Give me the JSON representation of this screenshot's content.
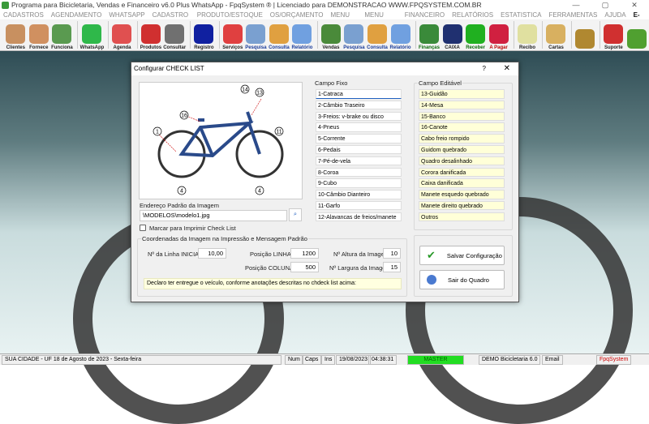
{
  "window": {
    "title": "Programa para Bicicletaria, Vendas e Financeiro v6.0 Plus WhatsApp - FpqSystem ® | Licenciado para  DEMONSTRACAO WWW.FPQSYSTEM.COM.BR",
    "minimize": "—",
    "maximize": "▢",
    "close": "✕"
  },
  "menu": [
    "CADASTROS",
    "AGENDAMENTO",
    "WHATSAPP",
    "CADASTRO BICICLETAS",
    "PRODUTO/ESTOQUE",
    "OS/ORÇAMENTO",
    "MENU VENDAS",
    "MENU COMPRAS",
    "FINANCEIRO",
    "RELATÓRIOS",
    "ESTATISTICA",
    "FERRAMENTAS",
    "AJUDA",
    "E-MAIL"
  ],
  "toolbar": [
    {
      "label": "Clientes",
      "color": "#c89060"
    },
    {
      "label": "Fornece",
      "color": "#d09060"
    },
    {
      "label": "Funciona",
      "color": "#5a9a50"
    },
    {
      "label": "WhatsApp",
      "color": "#2fb84a"
    },
    {
      "label": "Agenda",
      "color": "#e05050"
    },
    {
      "label": "Produtos",
      "color": "#d03030"
    },
    {
      "label": "Consultar",
      "color": "#707070"
    },
    {
      "label": "Registro",
      "color": "#1020a0"
    },
    {
      "label": "Serviços",
      "color": "#e04040"
    },
    {
      "label": "Pesquisa",
      "color": "#7aa0d0"
    },
    {
      "label": "Consulta",
      "color": "#e0a040"
    },
    {
      "label": "Relatório",
      "color": "#70a0e0"
    },
    {
      "label": "Vendas",
      "color": "#4a8a3a"
    },
    {
      "label": "Pesquisa",
      "color": "#7aa0d0"
    },
    {
      "label": "Consulta",
      "color": "#e0a040"
    },
    {
      "label": "Relatório",
      "color": "#70a0e0"
    },
    {
      "label": "Finanças",
      "color": "#3a8a3a"
    },
    {
      "label": "CAIXA",
      "color": "#203070"
    },
    {
      "label": "Receber",
      "color": "#20b020"
    },
    {
      "label": "A Pagar",
      "color": "#d02040"
    },
    {
      "label": "Recibo",
      "color": "#e0e0a0"
    },
    {
      "label": "Cartas",
      "color": "#d8b060"
    },
    {
      "label": "",
      "color": "#b08830"
    },
    {
      "label": "Suporte",
      "color": "#d03030"
    },
    {
      "label": "",
      "color": "#50a030"
    }
  ],
  "dialog": {
    "title": "Configurar CHECK LIST",
    "help": "?",
    "close": "✕",
    "image_path_label": "Endereço Padrão da Imagem",
    "image_path": "\\MODELOS\\modelo1.jpg",
    "print_checkbox_label": "Marcar para Imprimir Check List",
    "print_checked": false,
    "campo_fixo_label": "Campo Fixo",
    "campo_fixo": [
      "1-Catraca",
      "2-Câmbio Traseiro",
      "3-Freios: v-brake ou disco",
      "4-Pneus",
      "5-Corrente",
      "6-Pedais",
      "7-Pé-de-vela",
      "8-Coroa",
      "9-Cubo",
      "10-Câmbio Dianteiro",
      "11-Garfo",
      "12-Alavancas de freios/manete"
    ],
    "campo_editavel_label": "Campo Editável",
    "campo_editavel": [
      "13-Guidão",
      "14-Mesa",
      "15-Banco",
      "16-Canote",
      "Cabo freio rompido",
      "Guidom quebrado",
      "Quadro desalinhado",
      "Corora danificada",
      "Caixa danificada",
      "Manete esquedo quebrado",
      "Manete direito quebrado",
      "Outros"
    ],
    "coords_label": "Coordenadas da Imagem na Impressão e Mensagem Padrão",
    "linha_inicial_label": "Nº da Linha INICIAL",
    "linha_inicial": "10,00",
    "pos_linha_label": "Posição LINHA",
    "pos_linha": "1200",
    "pos_coluna_label": "Posição COLUNA",
    "pos_coluna": "500",
    "altura_label": "Nº Altura da Imagem",
    "altura": "10",
    "largura_label": "Nº Largura da Imagem",
    "largura": "15",
    "message": "Declaro ter entregue o veículo, conforme anotações descritas no chdeck list acima:",
    "save_label": "Salvar Configuração",
    "exit_label": "Sair do Quadro"
  },
  "status": {
    "city": "SUA CIDADE - UF 18 de Agosto de 2023 - Sexta-feira",
    "num": "Num",
    "caps": "Caps",
    "ins": "Ins",
    "date": "19/08/2023",
    "time": "04:38:31",
    "user": "MASTER",
    "version": "DEMO Bicicletaria 6.0",
    "email": "Email",
    "brand": "FpqSystem"
  }
}
